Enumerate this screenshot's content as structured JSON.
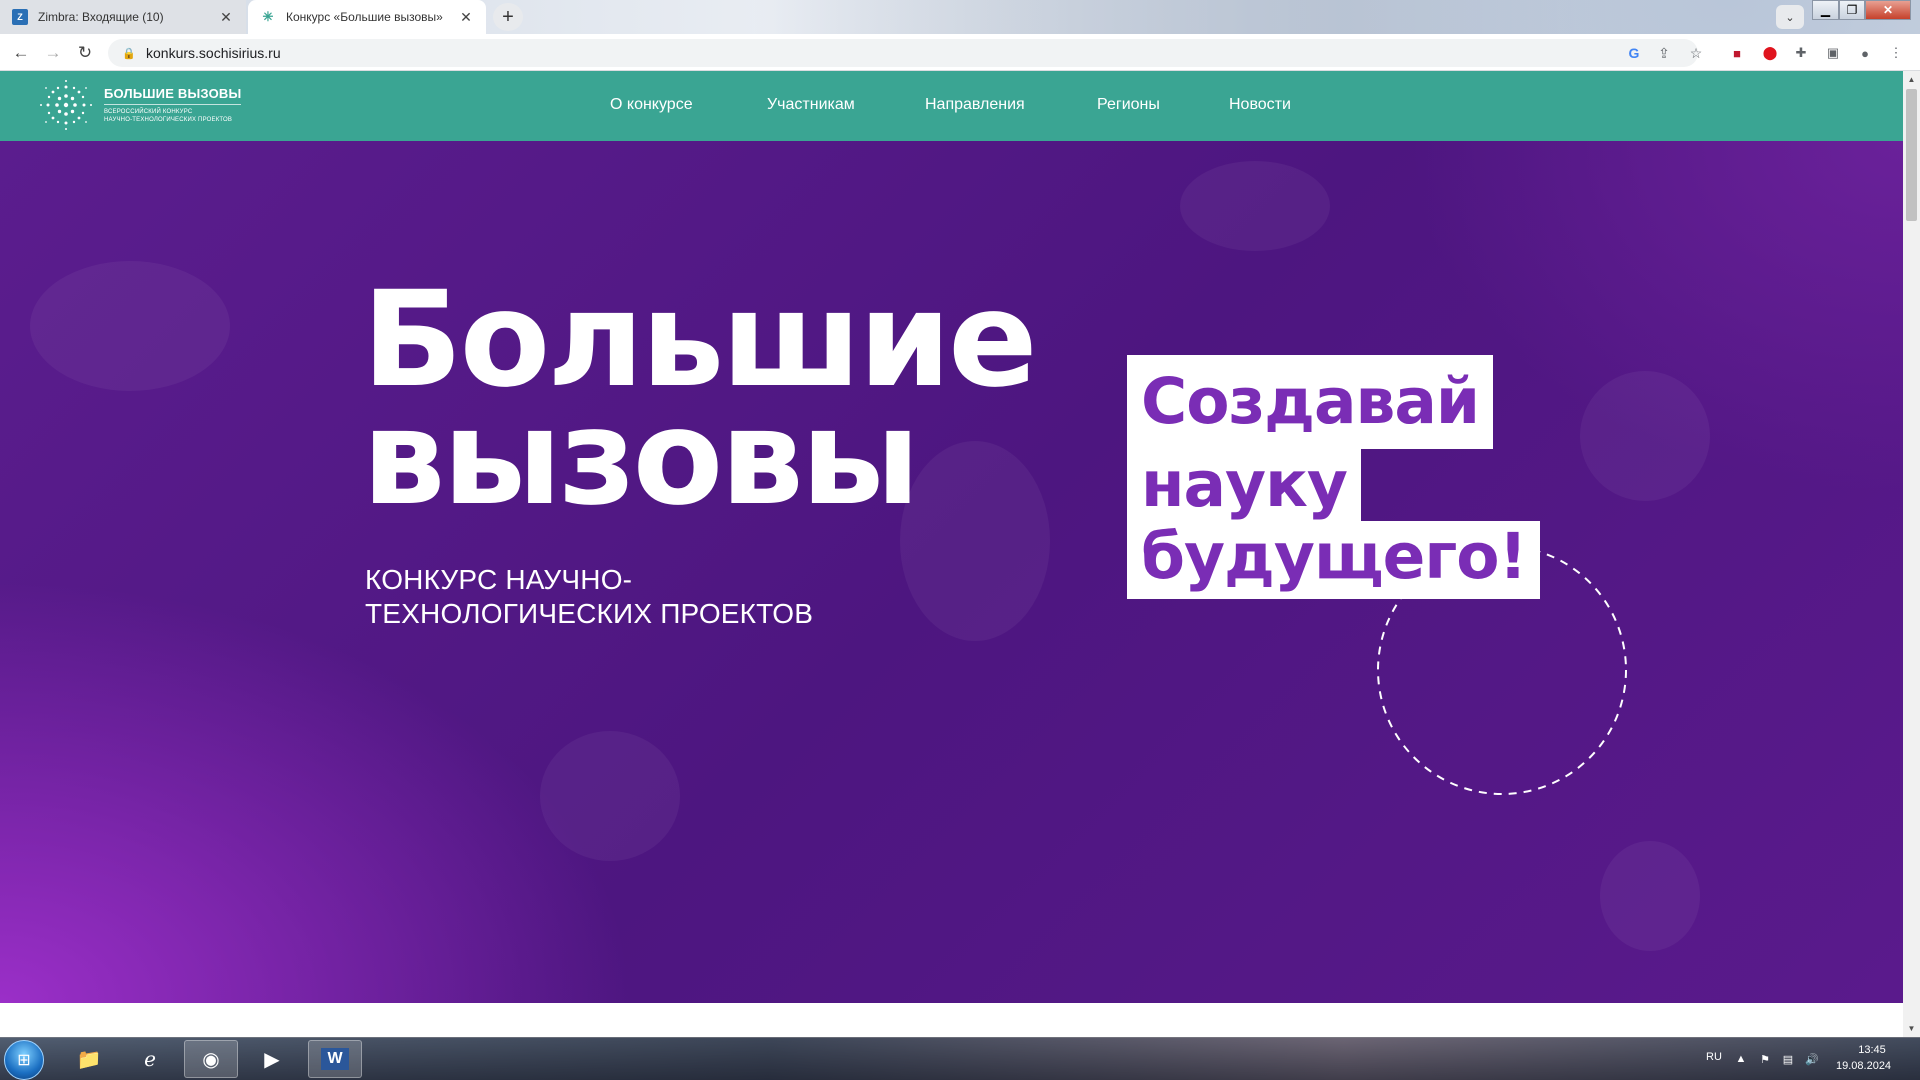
{
  "browser": {
    "tabs": [
      {
        "title": "Zimbra: Входящие (10)",
        "favicon": "zimbra-icon",
        "active": false
      },
      {
        "title": "Конкурс «Большие вызовы»",
        "favicon": "snowflake-icon",
        "active": true
      }
    ],
    "url": "konkurs.sochisirius.ru"
  },
  "site": {
    "logo": {
      "title": "БОЛЬШИЕ ВЫЗОВЫ",
      "subtitle_line1": "ВСЕРОССИЙСКИЙ КОНКУРС",
      "subtitle_line2": "НАУЧНО-ТЕХНОЛОГИЧЕСКИХ ПРОЕКТОВ"
    },
    "menu": [
      "О конкурсе",
      "Участникам",
      "Направления",
      "Регионы",
      "Новости"
    ],
    "hero": {
      "title_line1": "Большие",
      "title_line2": "вызовы",
      "subtitle_line1": "КОНКУРС НАУЧНО-",
      "subtitle_line2": "ТЕХНОЛОГИЧЕСКИХ ПРОЕКТОВ",
      "cta_line1": "Создавай",
      "cta_line2": "науку",
      "cta_line3": "будущего!"
    },
    "colors": {
      "nav": "#3aa593",
      "hero": "#5b1d8e",
      "cta_text": "#7a2db5"
    }
  },
  "taskbar": {
    "language": "RU",
    "time": "13:45",
    "date": "19.08.2024"
  }
}
